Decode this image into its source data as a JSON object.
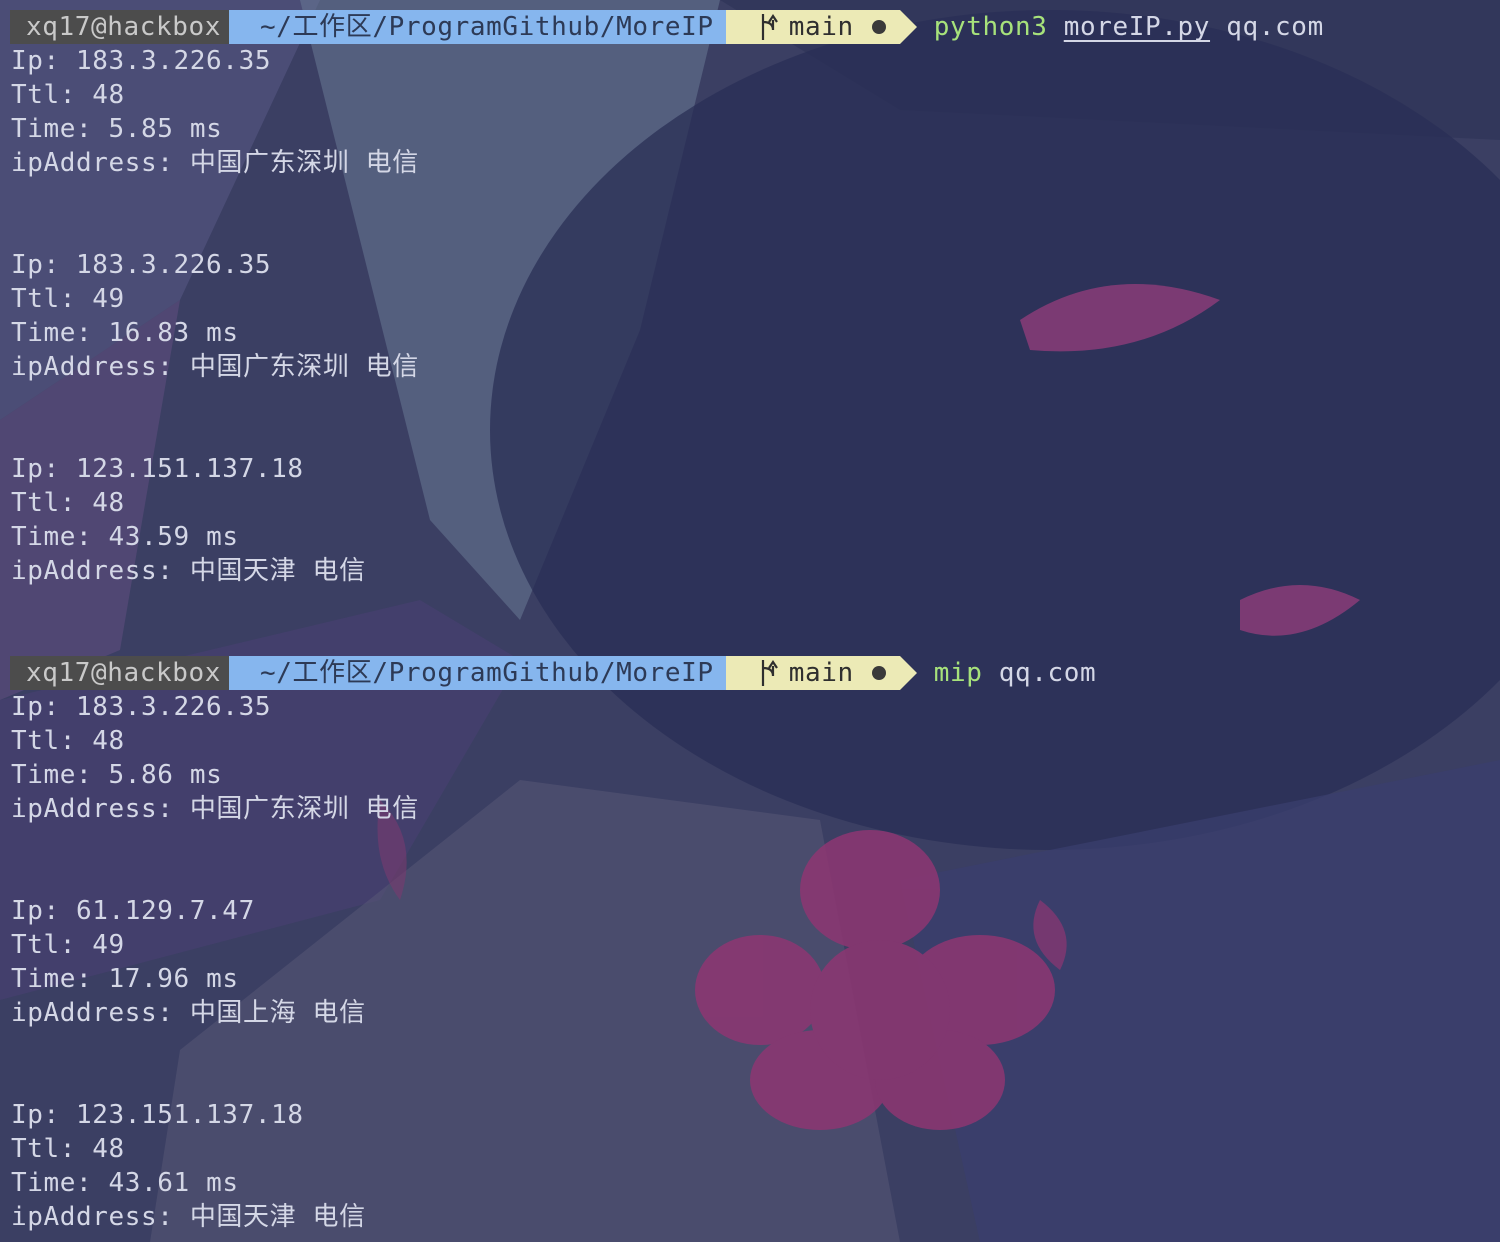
{
  "prompt": {
    "user_host": "xq17@hackbox",
    "path": "~/工作区/ProgramGithub/MoreIP",
    "branch": "main",
    "git_icon": "git-branch-icon",
    "dirty_indicator": "●"
  },
  "colors": {
    "user_bg": "#4c4c4c",
    "path_bg": "#86b6ee",
    "git_bg": "#eceab6",
    "command_green": "#a7e27b",
    "text": "#d4d7e6"
  },
  "commands": [
    {
      "exe": "python3",
      "arg_file": "moreIP.py",
      "arg": "qq.com"
    },
    {
      "exe": "mip",
      "arg_file": "",
      "arg": "qq.com"
    }
  ],
  "labels": {
    "ip": "Ip:",
    "ttl": "Ttl:",
    "time": "Time:",
    "addr": "ipAddress:"
  },
  "runs": [
    {
      "results": [
        {
          "ip": "183.3.226.35",
          "ttl": "48",
          "time": "5.85 ms",
          "addr": "中国广东深圳 电信"
        },
        {
          "ip": "183.3.226.35",
          "ttl": "49",
          "time": "16.83 ms",
          "addr": "中国广东深圳 电信"
        },
        {
          "ip": "123.151.137.18",
          "ttl": "48",
          "time": "43.59 ms",
          "addr": "中国天津 电信"
        }
      ]
    },
    {
      "results": [
        {
          "ip": "183.3.226.35",
          "ttl": "48",
          "time": "5.86 ms",
          "addr": "中国广东深圳 电信"
        },
        {
          "ip": "61.129.7.47",
          "ttl": "49",
          "time": "17.96 ms",
          "addr": "中国上海 电信"
        },
        {
          "ip": "123.151.137.18",
          "ttl": "48",
          "time": "43.61 ms",
          "addr": "中国天津 电信"
        }
      ]
    }
  ]
}
